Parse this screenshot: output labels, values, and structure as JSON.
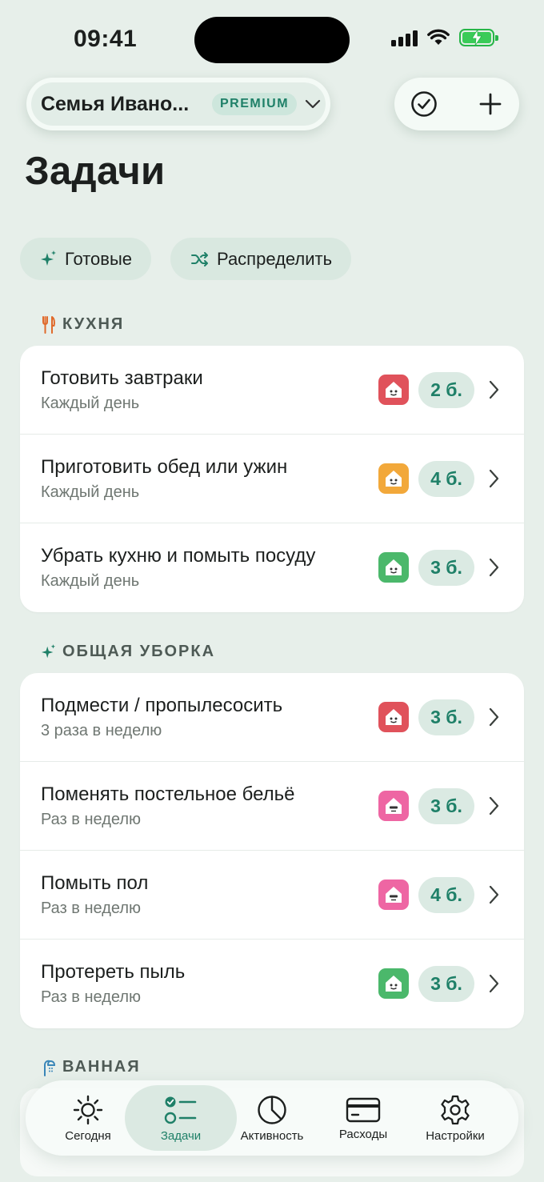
{
  "status": {
    "time": "09:41"
  },
  "header": {
    "family_name": "Семья Ивано...",
    "badge": "PREMIUM",
    "page_title": "Задачи"
  },
  "chips": {
    "ready": "Готовые",
    "distribute": "Распределить"
  },
  "sections": [
    {
      "title": "КУХНЯ",
      "icon": "fork-knife-icon",
      "tasks": [
        {
          "title": "Готовить завтраки",
          "freq": "Каждый день",
          "avatar_color": "#e0525b",
          "points": "2 б."
        },
        {
          "title": "Приготовить обед или ужин",
          "freq": "Каждый день",
          "avatar_color": "#f2a83a",
          "points": "4 б."
        },
        {
          "title": "Убрать кухню и помыть посуду",
          "freq": "Каждый день",
          "avatar_color": "#4bb86b",
          "points": "3 б."
        }
      ]
    },
    {
      "title": "ОБЩАЯ УБОРКА",
      "icon": "sparkles-icon",
      "tasks": [
        {
          "title": "Подмести / пропылесосить",
          "freq": "3 раза в неделю",
          "avatar_color": "#e0525b",
          "points": "3 б."
        },
        {
          "title": "Поменять постельное бельё",
          "freq": "Раз в неделю",
          "avatar_color": "#ee66a3",
          "points": "3 б."
        },
        {
          "title": "Помыть пол",
          "freq": "Раз в неделю",
          "avatar_color": "#ee66a3",
          "points": "4 б."
        },
        {
          "title": "Протереть пыль",
          "freq": "Раз в неделю",
          "avatar_color": "#4bb86b",
          "points": "3 б."
        }
      ]
    },
    {
      "title": "ВАННАЯ",
      "icon": "shower-icon"
    }
  ],
  "tabs": [
    {
      "label": "Сегодня",
      "icon": "sun-icon"
    },
    {
      "label": "Задачи",
      "icon": "tasks-list-icon"
    },
    {
      "label": "Активность",
      "icon": "pie-chart-icon"
    },
    {
      "label": "Расходы",
      "icon": "credit-card-icon"
    },
    {
      "label": "Настройки",
      "icon": "gear-icon"
    }
  ],
  "colors": {
    "accent": "#1f8068",
    "background": "#e7efea",
    "kitchen_icon": "#e06a2b",
    "sparkle": "#1f8068"
  }
}
